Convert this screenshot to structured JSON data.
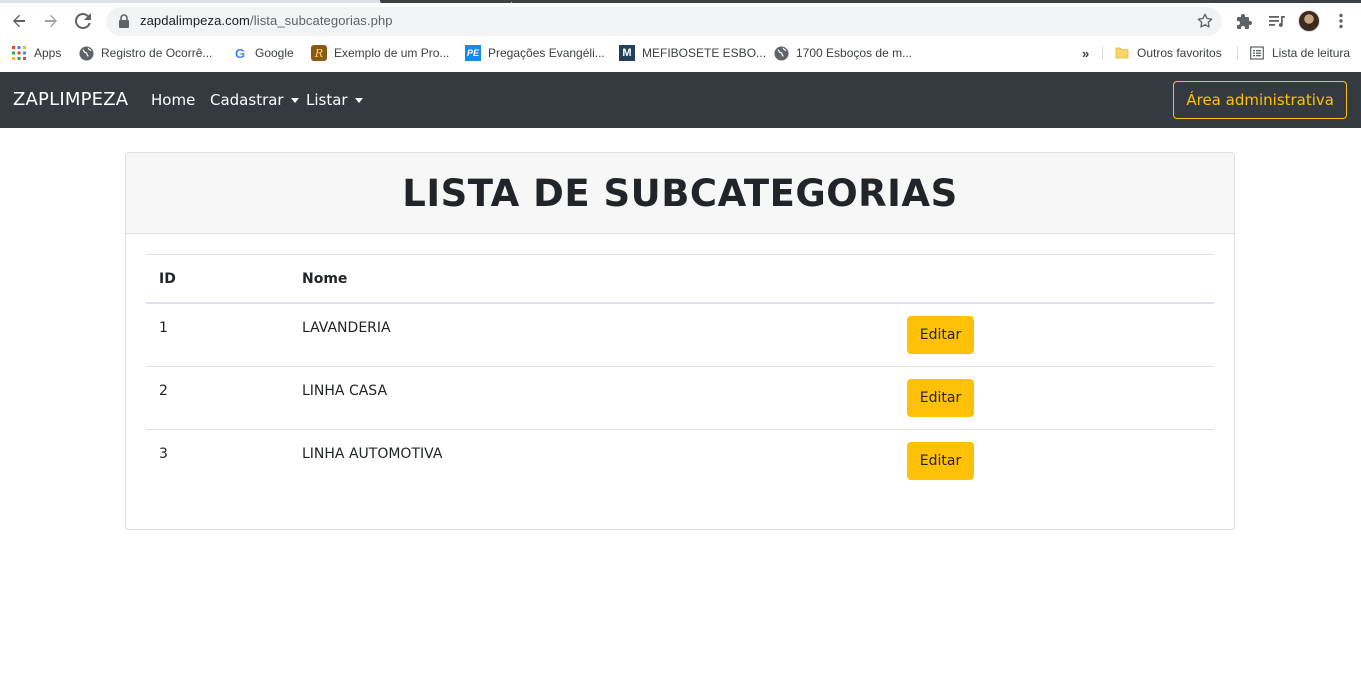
{
  "browser": {
    "url_host": "zapdalimpeza.com",
    "url_path": "/lista_subcategorias.php",
    "bookmarks": [
      {
        "label": "Apps",
        "icon": "apps-grid-icon"
      },
      {
        "label": "Registro de Ocorrê...",
        "icon": "globe-icon"
      },
      {
        "label": "Google",
        "icon": "google-icon"
      },
      {
        "label": "Exemplo de um Pro...",
        "icon": "r-logo-icon"
      },
      {
        "label": "Pregações Evangéli...",
        "icon": "pe-logo-icon"
      },
      {
        "label": "MEFIBOSETE ESBO...",
        "icon": "m-logo-icon"
      },
      {
        "label": "1700 Esboços de m...",
        "icon": "globe-icon"
      }
    ],
    "more_bookmarks": "»",
    "other_favorites": "Outros favoritos",
    "reading_list": "Lista de leitura"
  },
  "navbar": {
    "brand": "ZAPLIMPEZA",
    "links": [
      {
        "label": "Home"
      },
      {
        "label": "Cadastrar"
      },
      {
        "label": "Listar"
      }
    ],
    "admin_button": "Área administrativa"
  },
  "card": {
    "title": "LISTA DE SUBCATEGORIAS",
    "table": {
      "headers": [
        "ID",
        "Nome"
      ],
      "rows": [
        {
          "id": "1",
          "name": "LAVANDERIA",
          "action": "Editar"
        },
        {
          "id": "2",
          "name": "LINHA CASA",
          "action": "Editar"
        },
        {
          "id": "3",
          "name": "LINHA AUTOMOTIVA",
          "action": "Editar"
        }
      ]
    }
  },
  "colors": {
    "navbar_bg": "#343a40",
    "accent": "#ffc107",
    "text": "#212529"
  }
}
